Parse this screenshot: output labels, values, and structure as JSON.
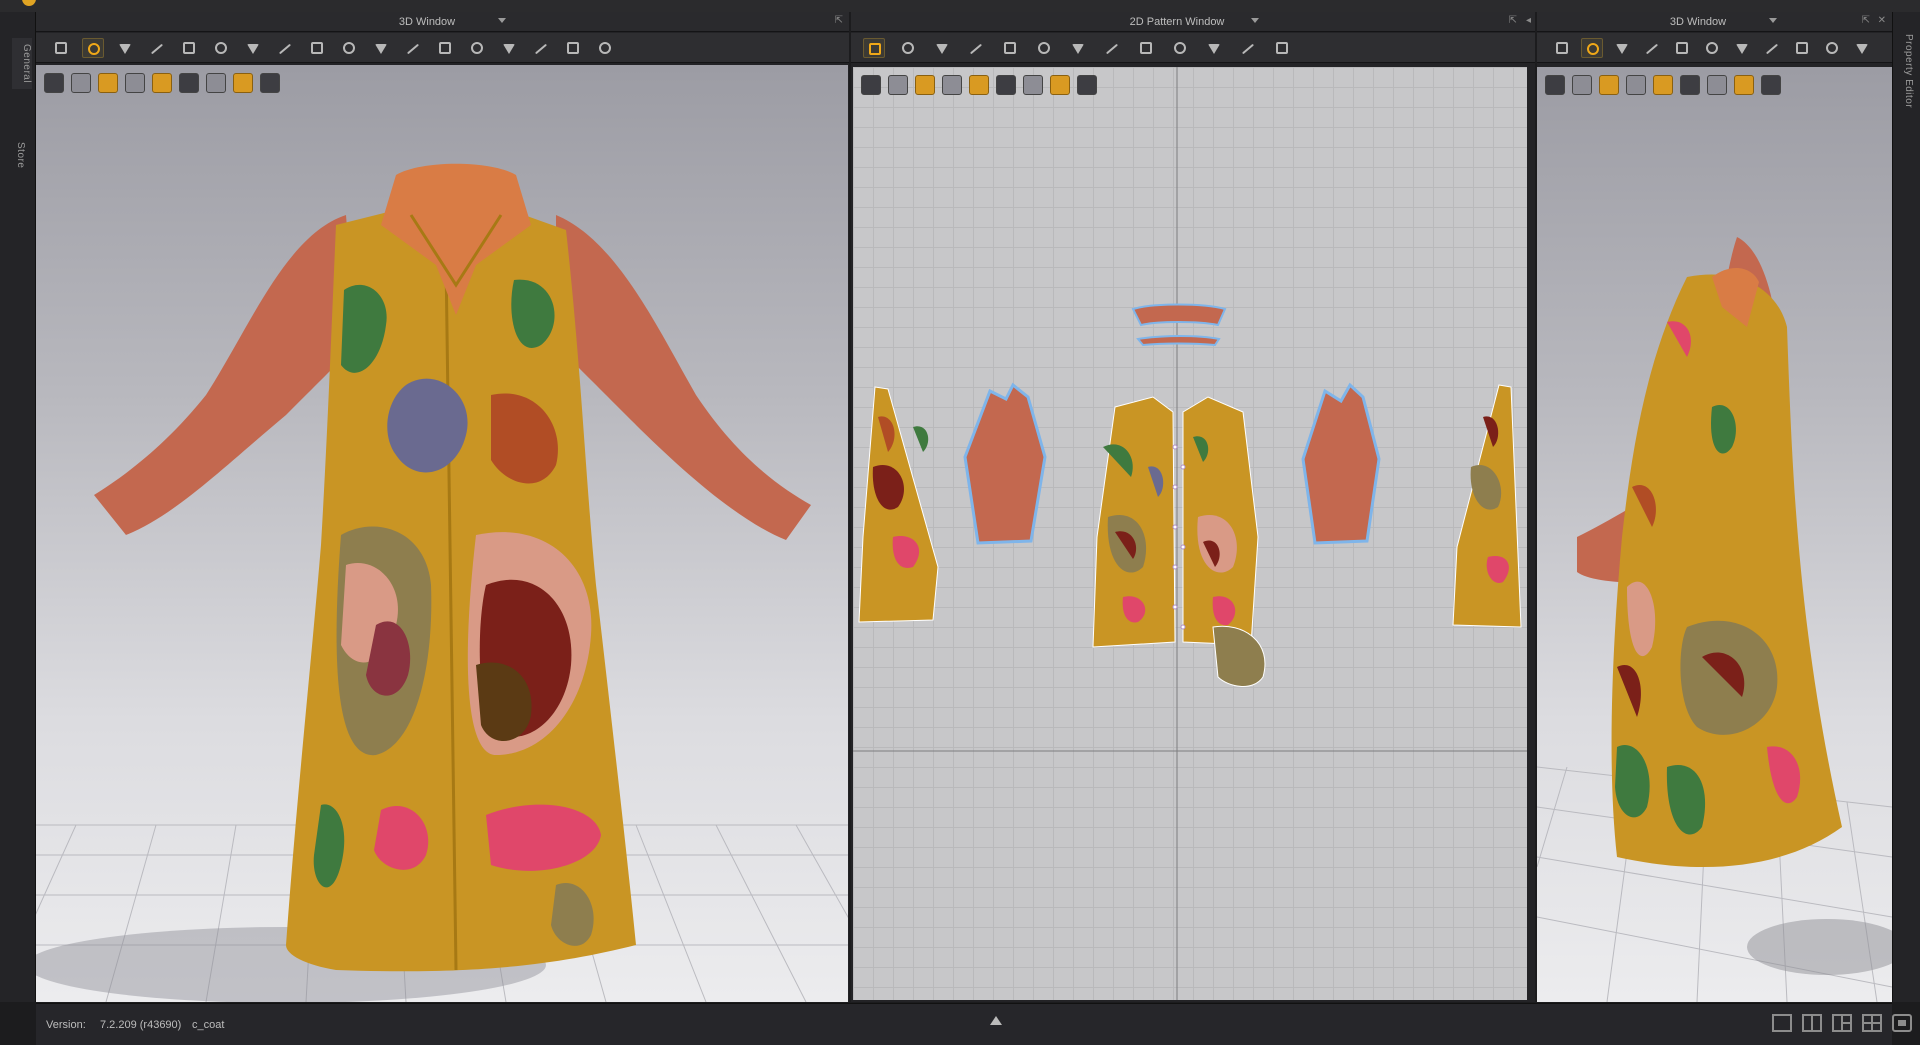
{
  "app": {
    "rails": {
      "left_tabs": [
        "General",
        "Store"
      ],
      "right_tab": "Property Editor"
    }
  },
  "panels": {
    "left3d": {
      "title": "3D Window",
      "window_buttons": [
        "⇱"
      ]
    },
    "pattern2d": {
      "title": "2D Pattern Window",
      "window_buttons": [
        "⇱",
        "◂"
      ]
    },
    "right3d": {
      "title": "3D Window",
      "window_buttons": [
        "⇱",
        "✕"
      ]
    }
  },
  "toolbars": {
    "left3d_tools": [
      "select-move",
      "transform",
      "edit-pattern",
      "fold",
      "tack",
      "segment",
      "sewing",
      "pin",
      "fit",
      "arrange",
      "gather",
      "measure",
      "raise",
      "tuck",
      "blend",
      "stitch",
      "split",
      "avatar-pose"
    ],
    "pattern2d_tools": [
      "transform",
      "edit-point",
      "rectangle",
      "internal-shape",
      "dart",
      "sewing",
      "grid-mesh",
      "fold",
      "trace",
      "segment",
      "stripe",
      "measure",
      "garment"
    ],
    "right3d_tools": [
      "select-move",
      "transform",
      "edit-pattern",
      "fold",
      "tack",
      "segment",
      "sewing",
      "pin",
      "fit",
      "arrange",
      "gather"
    ]
  },
  "viewport_tools": [
    "camera",
    "avatar",
    "texture",
    "shading",
    "light",
    "flat",
    "avatar-display",
    "render",
    "export"
  ],
  "status": {
    "version_label": "Version:",
    "version_value": "7.2.209 (r43690)",
    "project": "c_coat"
  },
  "colors": {
    "coat_mustard": "#c99524",
    "coat_mustard_dark": "#a77914",
    "sleeve_terracotta": "#c3684f",
    "collar_orange": "#d97c45",
    "patch_green": "#3f7a3f",
    "patch_slate": "#6a6a90",
    "patch_rust": "#b14d25",
    "patch_pink": "#e0476a",
    "patch_olive": "#8e7e4e",
    "patch_blush": "#d99a86",
    "patch_maroon": "#7b2019",
    "accent_gold": "#f0a818",
    "selection_blue": "#7fb5ea"
  }
}
